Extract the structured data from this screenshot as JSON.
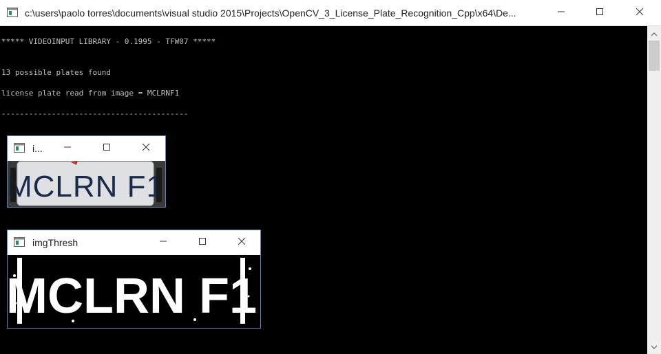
{
  "console_window": {
    "title": "c:\\users\\paolo torres\\documents\\visual studio 2015\\Projects\\OpenCV_3_License_Plate_Recognition_Cpp\\x64\\De...",
    "icon": "console-app-icon",
    "controls": {
      "minimize": "minimize-icon",
      "maximize": "maximize-icon",
      "close": "close-icon"
    }
  },
  "console": {
    "lines": [
      "***** VIDEOINPUT LIBRARY - 0.1995 - TFW07 *****",
      "13 possible plates found",
      "license plate read from image = MCLRNF1",
      "-----------------------------------------"
    ]
  },
  "plate_window": {
    "title": "i...",
    "image_text": "MCLRN F1",
    "image_kind": "color license plate crop"
  },
  "thresh_window": {
    "title": "imgThresh",
    "image_text": "MCLRN F1",
    "image_kind": "thresholded binary plate image"
  },
  "colors": {
    "console_bg": "#000000",
    "console_text": "#c0c0c0",
    "window_border": "#6b7fa0"
  }
}
